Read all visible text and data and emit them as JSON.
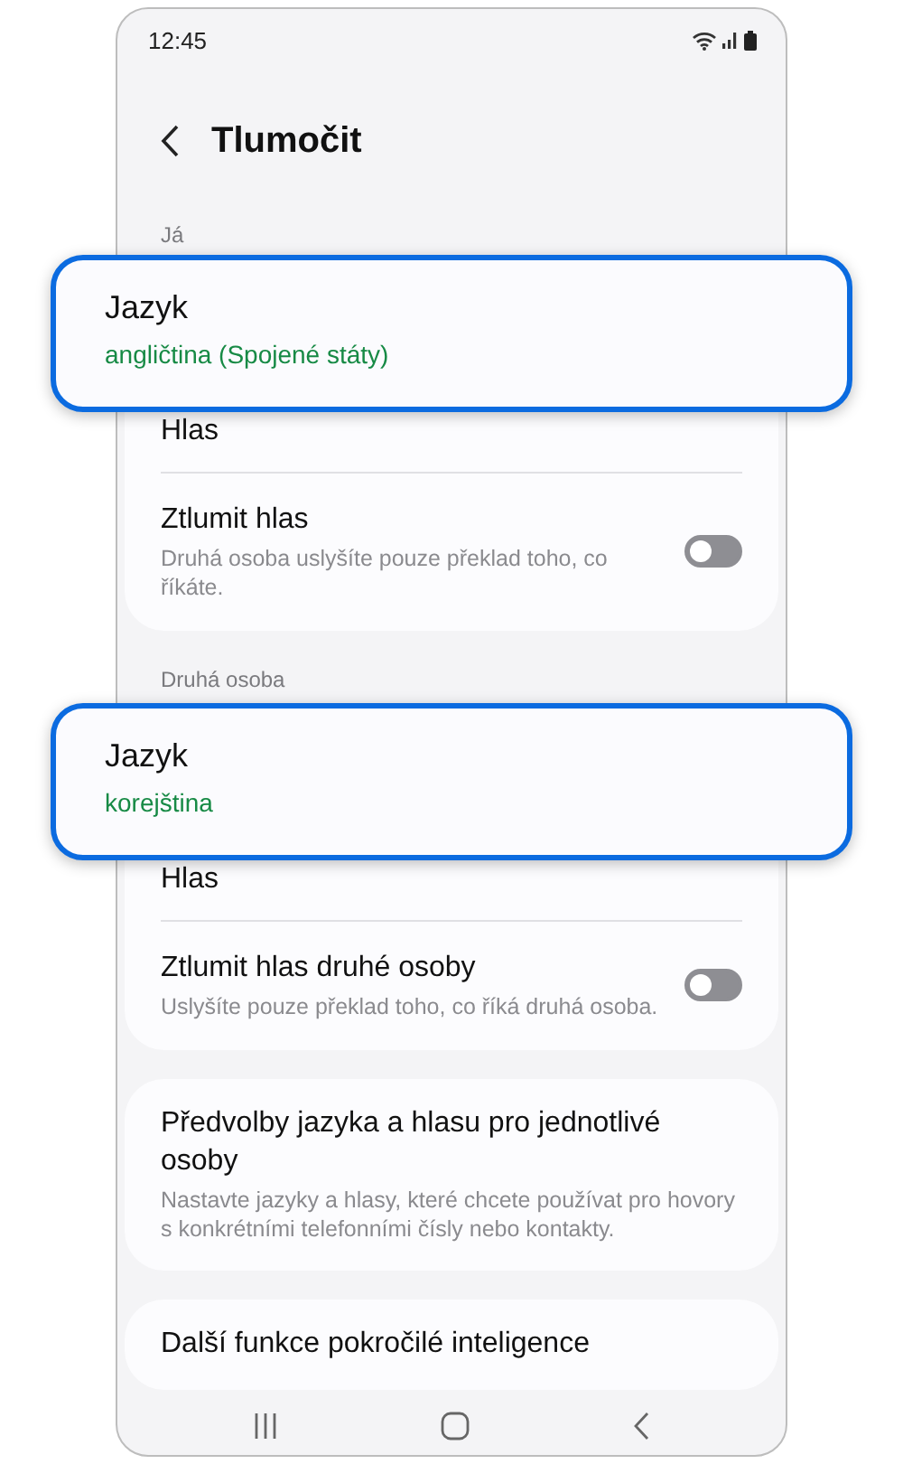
{
  "status_bar": {
    "time": "12:45"
  },
  "header": {
    "title": "Tlumočit"
  },
  "sections": [
    {
      "label": "Já",
      "items": [
        {
          "kind": "highlight",
          "title": "Jazyk",
          "value": "angličtina (Spojené státy)"
        },
        {
          "kind": "link",
          "title": "Hlas"
        },
        {
          "kind": "switch",
          "title": "Ztlumit hlas",
          "description": "Druhá osoba uslyšíte pouze překlad toho, co říkáte.",
          "on": false
        }
      ]
    },
    {
      "label": "Druhá osoba",
      "items": [
        {
          "kind": "highlight",
          "title": "Jazyk",
          "value": "korejština"
        },
        {
          "kind": "link",
          "title": "Hlas"
        },
        {
          "kind": "switch",
          "title": "Ztlumit hlas druhé osoby",
          "description": "Uslyšíte pouze překlad toho, co říká druhá osoba.",
          "on": false
        }
      ]
    },
    {
      "items": [
        {
          "kind": "link",
          "title": "Předvolby jazyka a hlasu pro jednotlivé osoby",
          "description": "Nastavte jazyky a hlasy, které chcete používat pro hovory s konkrétními telefonními čísly nebo kontakty."
        }
      ]
    },
    {
      "items": [
        {
          "kind": "link",
          "title": "Další funkce pokročilé inteligence"
        }
      ]
    }
  ]
}
